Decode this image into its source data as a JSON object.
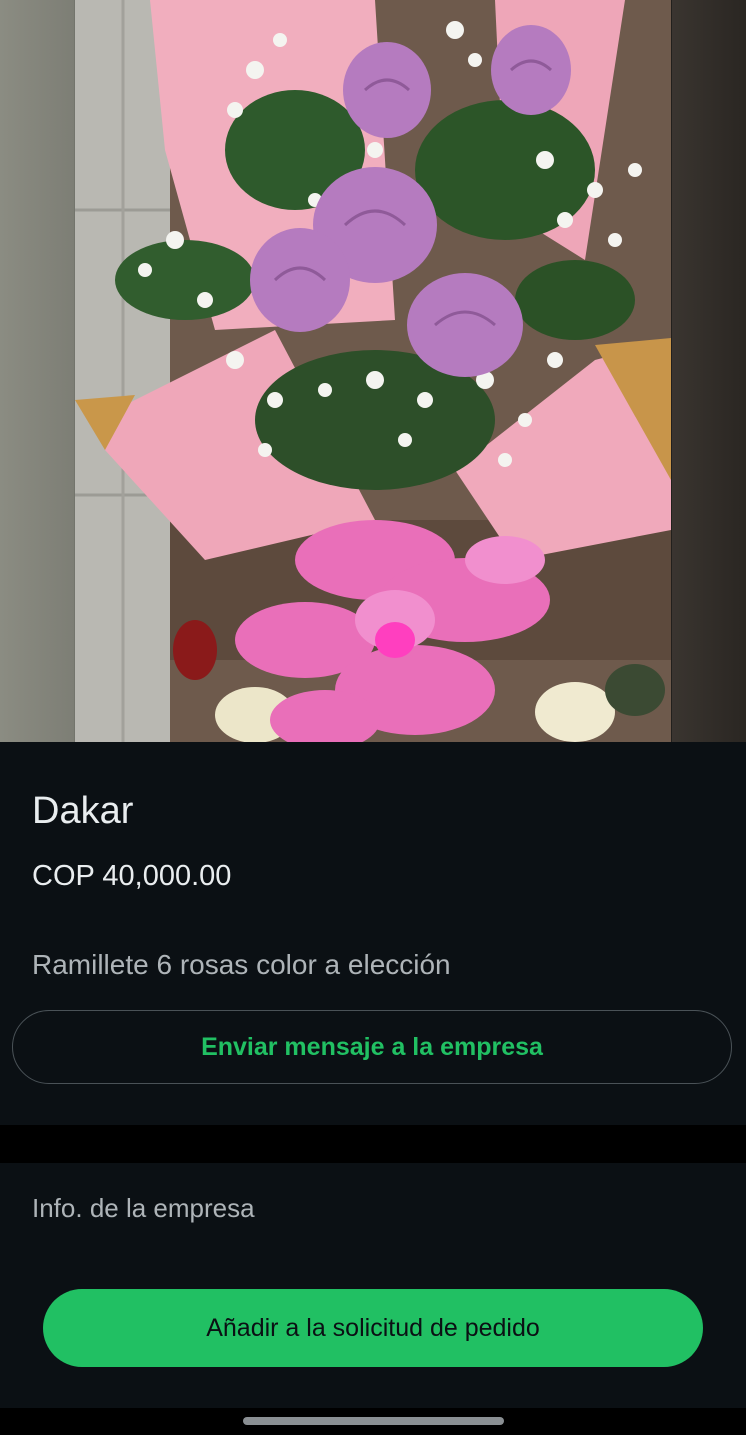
{
  "product": {
    "name": "Dakar",
    "price": "COP 40,000.00",
    "description": "Ramillete 6 rosas color a elección",
    "image_alt": "Ramillete de rosas lilas con flores blancas, papel rosado y lazo rosado"
  },
  "actions": {
    "message_label": "Enviar mensaje a la empresa",
    "add_to_order_label": "Añadir a la solicitud de pedido"
  },
  "company": {
    "info_label": "Info. de la empresa"
  },
  "colors": {
    "accent": "#21c063",
    "background": "#0b1014",
    "text_primary": "#e9edef",
    "text_secondary": "#aeb4b8"
  }
}
